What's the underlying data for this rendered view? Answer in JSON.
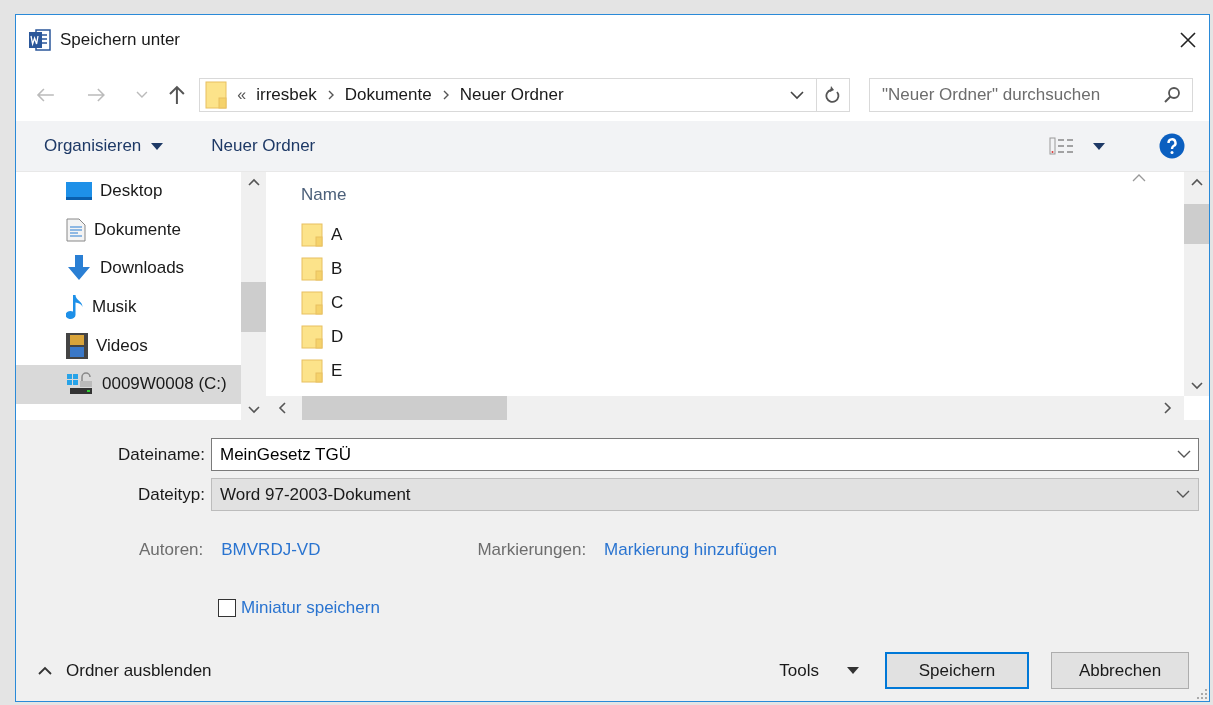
{
  "window": {
    "title": "Speichern unter"
  },
  "address": {
    "overflow": "«",
    "path": [
      "irresbek",
      "Dokumente",
      "Neuer Ordner"
    ]
  },
  "search": {
    "placeholder": "\"Neuer Ordner\" durchsuchen"
  },
  "toolbar": {
    "organize": "Organisieren",
    "new_folder": "Neuer Ordner"
  },
  "nav": {
    "items": [
      {
        "label": "Desktop",
        "kind": "desktop",
        "selected": false
      },
      {
        "label": "Dokumente",
        "kind": "documents",
        "selected": false
      },
      {
        "label": "Downloads",
        "kind": "downloads",
        "selected": false
      },
      {
        "label": "Musik",
        "kind": "music",
        "selected": false
      },
      {
        "label": "Videos",
        "kind": "videos",
        "selected": false
      },
      {
        "label": "0009W0008 (C:)",
        "kind": "drive",
        "selected": true
      }
    ]
  },
  "files": {
    "column": "Name",
    "items": [
      {
        "name": "A"
      },
      {
        "name": "B"
      },
      {
        "name": "C"
      },
      {
        "name": "D"
      },
      {
        "name": "E"
      }
    ]
  },
  "filename": {
    "label": "Dateiname:",
    "value": "MeinGesetz TGÜ"
  },
  "filetype": {
    "label": "Dateityp:",
    "value": "Word 97-2003-Dokument"
  },
  "meta": [
    {
      "label": "Autoren:",
      "value": "BMVRDJ-VD"
    },
    {
      "label": "Markierungen:",
      "value": "Markierung hinzufügen"
    }
  ],
  "thumbnail": {
    "label": "Miniatur speichern",
    "checked": false
  },
  "hide_folders": "Ordner ausblenden",
  "tools": "Tools",
  "buttons": [
    {
      "label": "Speichern",
      "default": true
    },
    {
      "label": "Abbrechen",
      "default": false
    }
  ]
}
